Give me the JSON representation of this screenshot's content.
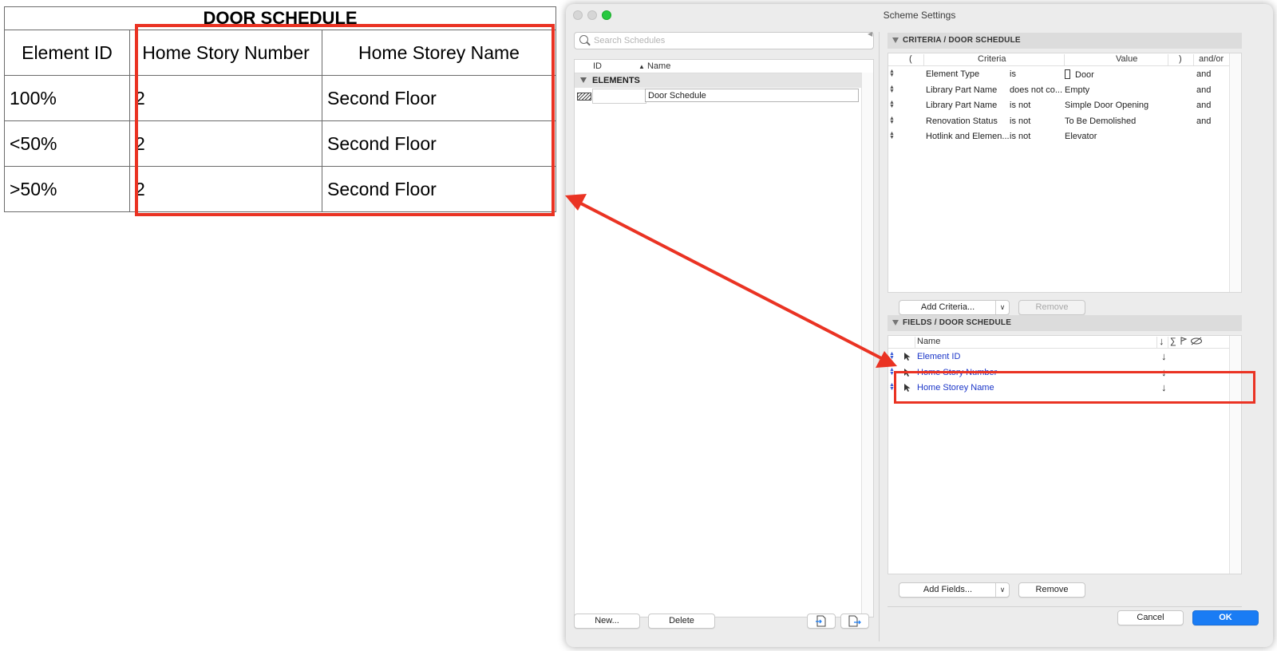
{
  "schedule": {
    "title": "DOOR SCHEDULE",
    "columns": [
      "Element ID",
      "Home Story Number",
      "Home Storey Name"
    ],
    "rows": [
      [
        "100%",
        "2",
        "Second Floor"
      ],
      [
        "<50%",
        "2",
        "Second Floor"
      ],
      [
        ">50%",
        "2",
        "Second Floor"
      ]
    ]
  },
  "annotation": {
    "color": "#ea3323"
  },
  "dialog": {
    "title": "Scheme Settings",
    "search_placeholder": "Search Schedules",
    "list": {
      "col_id": "ID",
      "col_name": "Name",
      "sort_glyph": "▲",
      "group": "ELEMENTS",
      "items": [
        {
          "id": "",
          "name": "Door Schedule"
        }
      ]
    },
    "buttons": {
      "new": "New...",
      "delete": "Delete",
      "cancel": "Cancel",
      "ok": "OK"
    }
  },
  "criteria": {
    "header": "CRITERIA /  DOOR SCHEDULE",
    "columns": {
      "open": "(",
      "criteria": "Criteria",
      "value": "Value",
      "close": ")",
      "andor": "and/or"
    },
    "rows": [
      {
        "field": "Element Type",
        "op": "is",
        "value": "Door",
        "andor": "and",
        "door_icon": true
      },
      {
        "field": "Library Part Name",
        "op": "does not co...",
        "value": "Empty",
        "andor": "and"
      },
      {
        "field": "Library Part Name",
        "op": "is not",
        "value": "Simple Door Opening",
        "andor": "and"
      },
      {
        "field": "Renovation Status",
        "op": "is not",
        "value": "To Be Demolished",
        "andor": "and"
      },
      {
        "field": "Hotlink and Elemen...",
        "op": "is not",
        "value": "Elevator",
        "andor": ""
      }
    ],
    "add_label": "Add Criteria...",
    "remove_label": "Remove"
  },
  "fields": {
    "header": "FIELDS /  DOOR SCHEDULE",
    "column_name": "Name",
    "column_icons": [
      "↓",
      "∑"
    ],
    "sort_glyph": "↓",
    "items": [
      "Element ID",
      "Home Story Number",
      "Home Storey Name"
    ],
    "add_label": "Add Fields...",
    "remove_label": "Remove"
  },
  "colors": {
    "ok_button": "#1a7cf4",
    "field_link": "#1a35c8",
    "traffic_green": "#28c840"
  }
}
